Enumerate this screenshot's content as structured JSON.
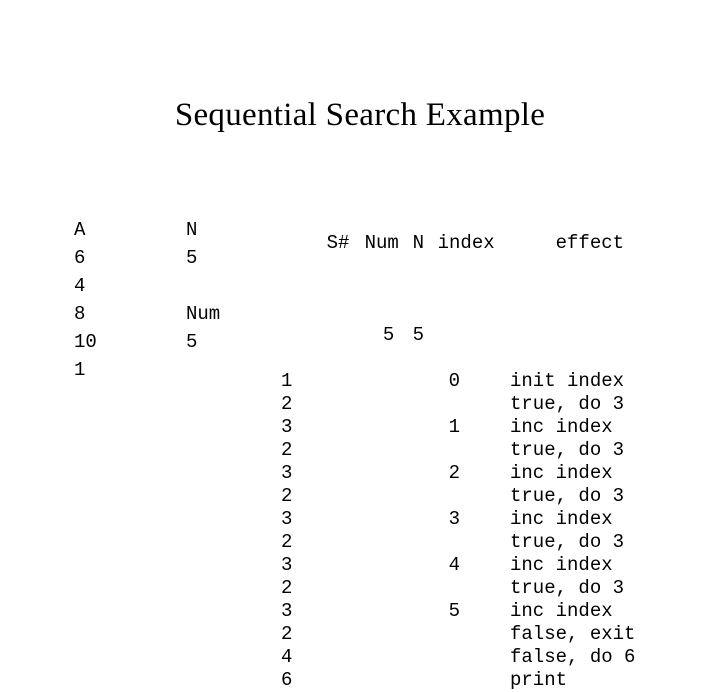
{
  "slide": {
    "title": "Sequential Search Example"
  },
  "left_block": {
    "array_header": "A",
    "var_header": "N",
    "rows": [
      {
        "a": "A",
        "n": "N"
      },
      {
        "a": "6",
        "n": "5"
      },
      {
        "a": "4",
        "n": ""
      },
      {
        "a": "8",
        "n": "Num"
      },
      {
        "a": "10",
        "n": "5"
      },
      {
        "a": "1",
        "n": ""
      }
    ]
  },
  "trace_table": {
    "headers": {
      "step": "S#",
      "num": "Num",
      "n": "N",
      "index": "index",
      "effect": "effect"
    },
    "initial_values": {
      "step": "",
      "num": "5",
      "n": "5",
      "index": "",
      "effect": ""
    },
    "rows": [
      {
        "step": "1",
        "num": "",
        "n": "",
        "index": "0",
        "effect": "init index"
      },
      {
        "step": "2",
        "num": "",
        "n": "",
        "index": "",
        "effect": "true, do 3"
      },
      {
        "step": "3",
        "num": "",
        "n": "",
        "index": "1",
        "effect": "inc index"
      },
      {
        "step": "2",
        "num": "",
        "n": "",
        "index": "",
        "effect": "true, do 3"
      },
      {
        "step": "3",
        "num": "",
        "n": "",
        "index": "2",
        "effect": "inc index"
      },
      {
        "step": "2",
        "num": "",
        "n": "",
        "index": "",
        "effect": "true, do 3"
      },
      {
        "step": "3",
        "num": "",
        "n": "",
        "index": "3",
        "effect": "inc index"
      },
      {
        "step": "2",
        "num": "",
        "n": "",
        "index": "",
        "effect": "true, do 3"
      },
      {
        "step": "3",
        "num": "",
        "n": "",
        "index": "4",
        "effect": "inc index"
      },
      {
        "step": "2",
        "num": "",
        "n": "",
        "index": "",
        "effect": "true, do 3"
      },
      {
        "step": "3",
        "num": "",
        "n": "",
        "index": "5",
        "effect": "inc index"
      },
      {
        "step": "2",
        "num": "",
        "n": "",
        "index": "",
        "effect": "false, exit"
      },
      {
        "step": "4",
        "num": "",
        "n": "",
        "index": "",
        "effect": "false, do 6"
      },
      {
        "step": "6",
        "num": "",
        "n": "",
        "index": "",
        "effect": "print"
      }
    ]
  },
  "colors": {
    "background": "#ffffff",
    "text": "#000000"
  }
}
